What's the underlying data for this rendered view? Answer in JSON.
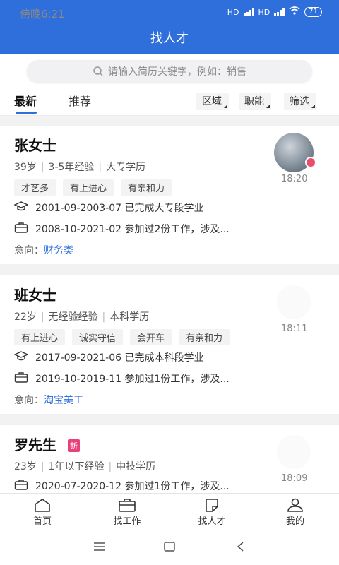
{
  "status": {
    "time": "傍晚6:21",
    "net1": "HD",
    "net2": "HD",
    "battery": "71"
  },
  "header": {
    "title": "找人才"
  },
  "search": {
    "placeholder": "请输入简历关键字，例如：销售"
  },
  "tabs": [
    {
      "label": "最新",
      "active": true
    },
    {
      "label": "推荐",
      "active": false
    }
  ],
  "filters": [
    {
      "label": "区域"
    },
    {
      "label": "职能"
    },
    {
      "label": "筛选"
    }
  ],
  "candidates": [
    {
      "name": "张女士",
      "badge": "",
      "age": "39岁",
      "experience": "3-5年经验",
      "education": "大专学历",
      "tags": [
        "才艺多",
        "有上进心",
        "有亲和力"
      ],
      "education_line": "2001-09-2003-07 已完成大专段学业",
      "work_line": "2008-10-2021-02 参加过2份工作，涉及...",
      "intent_label": "意向：",
      "intent_value": "财务类",
      "time": "18:20"
    },
    {
      "name": "班女士",
      "badge": "",
      "age": "22岁",
      "experience": "无经验经验",
      "education": "本科学历",
      "tags": [
        "有上进心",
        "诚实守信",
        "会开车",
        "有亲和力"
      ],
      "education_line": "2017-09-2021-06 已完成本科段学业",
      "work_line": "2019-10-2019-11 参加过1份工作，涉及...",
      "intent_label": "意向：",
      "intent_value": "淘宝美工",
      "time": "18:11"
    },
    {
      "name": "罗先生",
      "badge": "新",
      "age": "23岁",
      "experience": "1年以下经验",
      "education": "中技学历",
      "work_line": "2020-07-2020-12 参加过1份工作，涉及...",
      "time": "18:09"
    }
  ],
  "nav": [
    {
      "label": "首页"
    },
    {
      "label": "找工作"
    },
    {
      "label": "找人才"
    },
    {
      "label": "我的"
    }
  ],
  "colors": {
    "primary": "#2f6fdc",
    "badge": "#e93f7b",
    "link": "#2f6fdc"
  }
}
